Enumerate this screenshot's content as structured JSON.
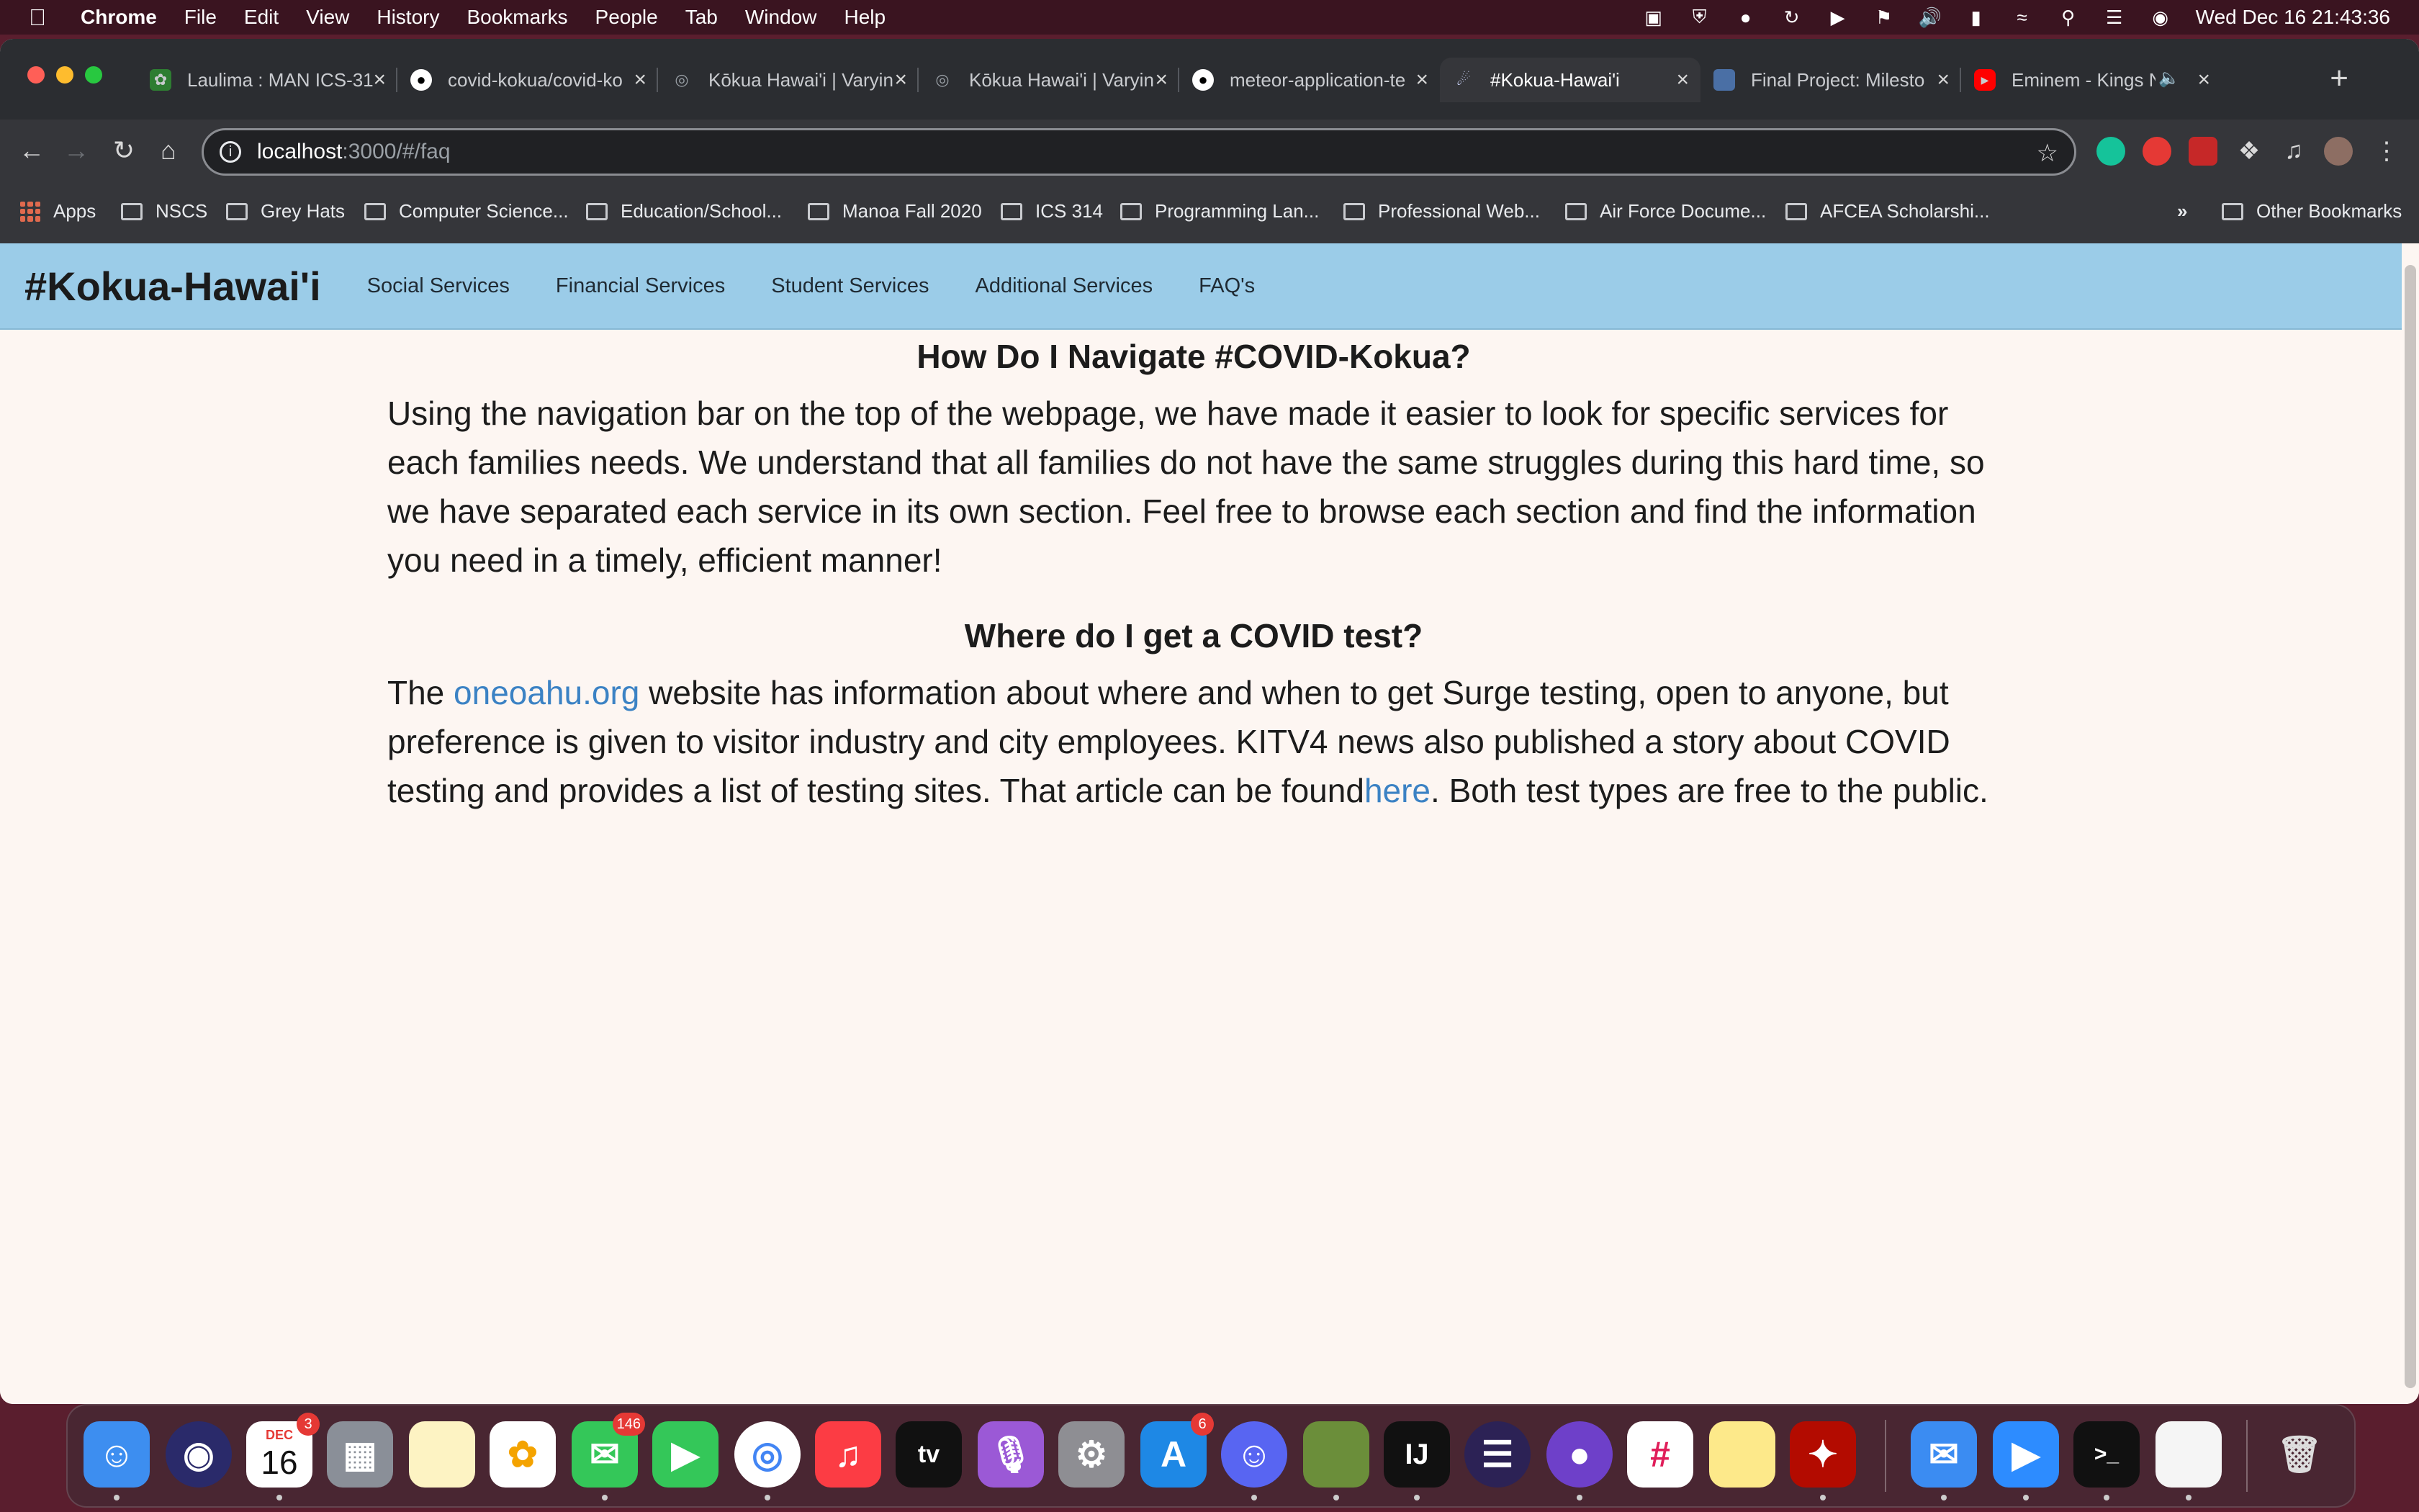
{
  "menubar": {
    "app": "Chrome",
    "items": [
      "File",
      "Edit",
      "View",
      "History",
      "Bookmarks",
      "People",
      "Tab",
      "Window",
      "Help"
    ],
    "clock": "Wed Dec 16  21:43:36"
  },
  "tabs": [
    {
      "label": "Laulima : MAN ICS-31",
      "icon": "laulima-icon"
    },
    {
      "label": "covid-kokua/covid-ko",
      "icon": "github-icon"
    },
    {
      "label": "Kōkua Hawai'i | Varyin",
      "icon": "globe-icon"
    },
    {
      "label": "Kōkua Hawai'i | Varyin",
      "icon": "globe-icon"
    },
    {
      "label": "meteor-application-te",
      "icon": "github-icon"
    },
    {
      "label": "#Kokua-Hawai'i",
      "icon": "meteor-icon",
      "active": true
    },
    {
      "label": "Final Project: Milesto",
      "icon": "page-icon"
    },
    {
      "label": "Eminem - Kings N",
      "icon": "youtube-icon"
    }
  ],
  "address": {
    "host": "localhost",
    "path": ":3000/#/faq"
  },
  "bookmarks": [
    "Apps",
    "NSCS",
    "Grey Hats",
    "Computer Science...",
    "Education/School...",
    "Manoa Fall 2020",
    "ICS 314",
    "Programming Lan...",
    "Professional Web...",
    "Air Force Docume...",
    "AFCEA Scholarshi..."
  ],
  "bookmarks_more": "»",
  "bookmarks_other": "Other Bookmarks",
  "site": {
    "brand": "#Kokua-Hawai'i",
    "nav": [
      "Social Services",
      "Financial Services",
      "Student Services",
      "Additional Services",
      "FAQ's"
    ]
  },
  "faq": {
    "q1": "How Do I Navigate #COVID-Kokua?",
    "a1": "Using the navigation bar on the top of the webpage, we have made it easier to look for specific services for each families needs. We understand that all families do not have the same struggles during this hard time, so we have separated each service in its own section. Feel free to browse each section and find the information you need in a timely, efficient manner!",
    "q2": "Where do I get a COVID test?",
    "a2_pre": "The ",
    "a2_link1": "oneoahu.org",
    "a2_mid": " website has information about where and when to get Surge testing, open to anyone, but preference is given to visitor industry and city employees. KITV4 news also published a story about COVID testing and provides a list of testing sites. That article can be found",
    "a2_link2": "here",
    "a2_post": ". Both test types are free to the public."
  },
  "dock": {
    "calendar": {
      "month": "DEC",
      "day": "16",
      "badge": "3"
    },
    "messages_badge": "146",
    "appstore_badge": "6",
    "tv_label": "tv",
    "intellij_label": "IJ"
  }
}
